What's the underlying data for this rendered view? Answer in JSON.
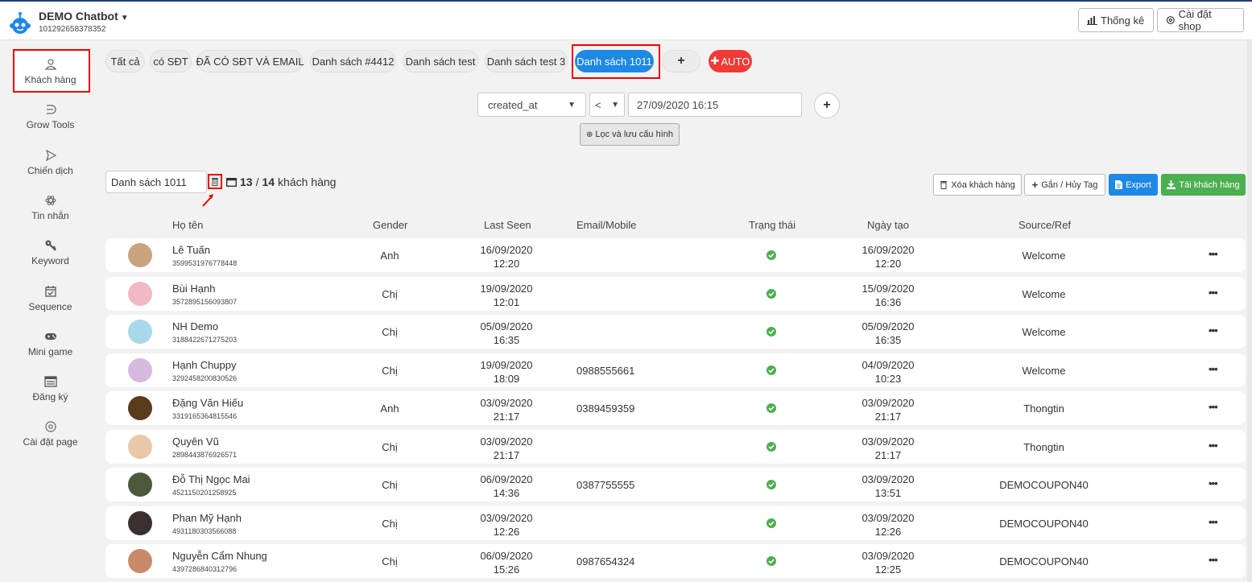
{
  "header": {
    "title": "DEMO Chatbot",
    "page_id": "101292658378352",
    "stats_label": "Thống kê",
    "settings_label": "Cài đặt shop"
  },
  "sidebar": {
    "items": [
      {
        "label": "Khách hàng",
        "icon": "user-icon"
      },
      {
        "label": "Grow Tools",
        "icon": "grow-tools-icon"
      },
      {
        "label": "Chiến dịch",
        "icon": "send-icon"
      },
      {
        "label": "Tin nhắn",
        "icon": "message-icon"
      },
      {
        "label": "Keyword",
        "icon": "key-icon"
      },
      {
        "label": "Sequence",
        "icon": "calendar-check-icon"
      },
      {
        "label": "Mini game",
        "icon": "gamepad-icon"
      },
      {
        "label": "Đăng ký",
        "icon": "list-icon"
      },
      {
        "label": "Cài đặt page",
        "icon": "gear-icon"
      }
    ]
  },
  "tabs": [
    "Tất cả",
    "có SĐT",
    "ĐÃ CÓ SĐT VÀ EMAIL",
    "Danh sách #4412",
    "Danh sách test",
    "Danh sách test 3",
    "Danh sách 1011"
  ],
  "tab_add": "+",
  "tab_auto": "AUTO",
  "filter": {
    "field": "created_at",
    "operator": "<",
    "value": "27/09/2020 16:15",
    "save_label": "Lọc và lưu cấu hình"
  },
  "list": {
    "name": "Danh sách 1011",
    "count_shown": "13",
    "count_sep": "/",
    "count_total": "14",
    "count_suffix": "khách hàng"
  },
  "actions": {
    "delete": "Xóa khách hàng",
    "tag": "Gắn / Hủy Tag",
    "export": "Export",
    "download": "Tải khách hàng"
  },
  "columns": {
    "name": "Họ tên",
    "gender": "Gender",
    "last_seen": "Last Seen",
    "email": "Email/Mobile",
    "status": "Trạng thái",
    "created": "Ngày tạo",
    "source": "Source/Ref"
  },
  "rows": [
    {
      "name": "Lê Tuấn",
      "id": "3599531976778448",
      "gender": "Anh",
      "seen_date": "16/09/2020",
      "seen_time": "12:20",
      "email": "",
      "created_date": "16/09/2020",
      "created_time": "12:20",
      "source": "Welcome",
      "avatar": "#c9a27e"
    },
    {
      "name": "Bùi Hạnh",
      "id": "3572895156093807",
      "gender": "Chị",
      "seen_date": "19/09/2020",
      "seen_time": "12:01",
      "email": "",
      "created_date": "15/09/2020",
      "created_time": "16:36",
      "source": "Welcome",
      "avatar": "#f2b8c6"
    },
    {
      "name": "NH Demo",
      "id": "3188422671275203",
      "gender": "Chị",
      "seen_date": "05/09/2020",
      "seen_time": "16:35",
      "email": "",
      "created_date": "05/09/2020",
      "created_time": "16:35",
      "source": "Welcome",
      "avatar": "#a8d8ea"
    },
    {
      "name": "Hạnh Chuppy",
      "id": "3292458200830526",
      "gender": "Chị",
      "seen_date": "19/09/2020",
      "seen_time": "18:09",
      "email": "0988555661",
      "created_date": "04/09/2020",
      "created_time": "10:23",
      "source": "Welcome",
      "avatar": "#d7b9e0"
    },
    {
      "name": "Đặng Văn Hiếu",
      "id": "3319165364815546",
      "gender": "Anh",
      "seen_date": "03/09/2020",
      "seen_time": "21:17",
      "email": "0389459359",
      "created_date": "03/09/2020",
      "created_time": "21:17",
      "source": "Thongtin",
      "avatar": "#5a3b1e"
    },
    {
      "name": "Quyên Vũ",
      "id": "2898443876926571",
      "gender": "Chị",
      "seen_date": "03/09/2020",
      "seen_time": "21:17",
      "email": "",
      "created_date": "03/09/2020",
      "created_time": "21:17",
      "source": "Thongtin",
      "avatar": "#e8c8a8"
    },
    {
      "name": "Đỗ Thị Ngọc Mai",
      "id": "4521150201258925",
      "gender": "Chị",
      "seen_date": "06/09/2020",
      "seen_time": "14:36",
      "email": "0387755555",
      "created_date": "03/09/2020",
      "created_time": "13:51",
      "source": "DEMOCOUPON40",
      "avatar": "#4a5a3a"
    },
    {
      "name": "Phan Mỹ Hạnh",
      "id": "4931180303566088",
      "gender": "Chị",
      "seen_date": "03/09/2020",
      "seen_time": "12:26",
      "email": "",
      "created_date": "03/09/2020",
      "created_time": "12:26",
      "source": "DEMOCOUPON40",
      "avatar": "#3a3030"
    },
    {
      "name": "Nguyễn Cẩm Nhung",
      "id": "4397286840312796",
      "gender": "Chị",
      "seen_date": "06/09/2020",
      "seen_time": "15:26",
      "email": "0987654324",
      "created_date": "03/09/2020",
      "created_time": "12:25",
      "source": "DEMOCOUPON40",
      "avatar": "#c98a6a"
    }
  ]
}
